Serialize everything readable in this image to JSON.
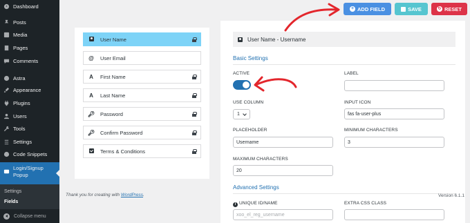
{
  "sidebar": {
    "items": [
      {
        "label": "Dashboard",
        "icon": "dashboard-icon"
      },
      {
        "label": "Posts",
        "icon": "pin-icon"
      },
      {
        "label": "Media",
        "icon": "media-icon"
      },
      {
        "label": "Pages",
        "icon": "pages-icon"
      },
      {
        "label": "Comments",
        "icon": "comments-icon"
      },
      {
        "label": "Astra",
        "icon": "astra-icon"
      },
      {
        "label": "Appearance",
        "icon": "brush-icon"
      },
      {
        "label": "Plugins",
        "icon": "plugin-icon"
      },
      {
        "label": "Users",
        "icon": "users-icon"
      },
      {
        "label": "Tools",
        "icon": "tools-icon"
      },
      {
        "label": "Settings",
        "icon": "settings-icon"
      },
      {
        "label": "Code Snippets",
        "icon": "code-icon"
      }
    ],
    "active": {
      "label_line1": "Login/Signup",
      "label_line2": "Popup",
      "icon": "popup-icon"
    },
    "submenu": [
      {
        "label": "Settings",
        "current": false
      },
      {
        "label": "Fields",
        "current": true
      }
    ],
    "collapse_label": "Collapse menu"
  },
  "toolbar": {
    "add_field_label": "ADD FIELD",
    "save_label": "SAVE",
    "reset_label": "RESET",
    "add_field_color": "#4a90e2",
    "save_color": "#56c5d0",
    "reset_color": "#dd3348"
  },
  "fields": [
    {
      "label": "User Name",
      "icon": "user-icon",
      "selected": true,
      "locked": true
    },
    {
      "label": "User Email",
      "icon": "at-icon",
      "selected": false,
      "locked": false
    },
    {
      "label": "First Name",
      "icon": "letter-a-icon",
      "selected": false,
      "locked": true
    },
    {
      "label": "Last Name",
      "icon": "letter-a-icon",
      "selected": false,
      "locked": true
    },
    {
      "label": "Password",
      "icon": "key-icon",
      "selected": false,
      "locked": true
    },
    {
      "label": "Confirm Password",
      "icon": "key-icon",
      "selected": false,
      "locked": true
    },
    {
      "label": "Terms & Conditions",
      "icon": "checkbox-icon",
      "selected": false,
      "locked": true
    }
  ],
  "settings": {
    "header": "User Name - Username",
    "basic_title": "Basic Settings",
    "active_label": "ACTIVE",
    "active_on": true,
    "label_label": "LABEL",
    "label_value": "",
    "use_column_label": "USE COLUMN",
    "use_column_value": "1",
    "input_icon_label": "INPUT ICON",
    "input_icon_value": "fas fa-user-plus",
    "placeholder_label": "PLACEHOLDER",
    "placeholder_value": "Username",
    "min_chars_label": "MINIMUM CHARACTERS",
    "min_chars_value": "3",
    "max_chars_label": "MAXIMUM CHARACTERS",
    "max_chars_value": "20",
    "advanced_title": "Advanced Settings",
    "unique_id_label": "UNIQUE ID/NAME",
    "unique_id_placeholder": "xoo_el_reg_username",
    "extra_css_label": "EXTRA CSS CLASS",
    "extra_css_value": ""
  },
  "footer": {
    "thanks_prefix": "Thank you for creating with ",
    "thanks_link": "WordPress",
    "thanks_suffix": ".",
    "version": "Version 6.1.1"
  },
  "annotation_color": "#e3262c"
}
